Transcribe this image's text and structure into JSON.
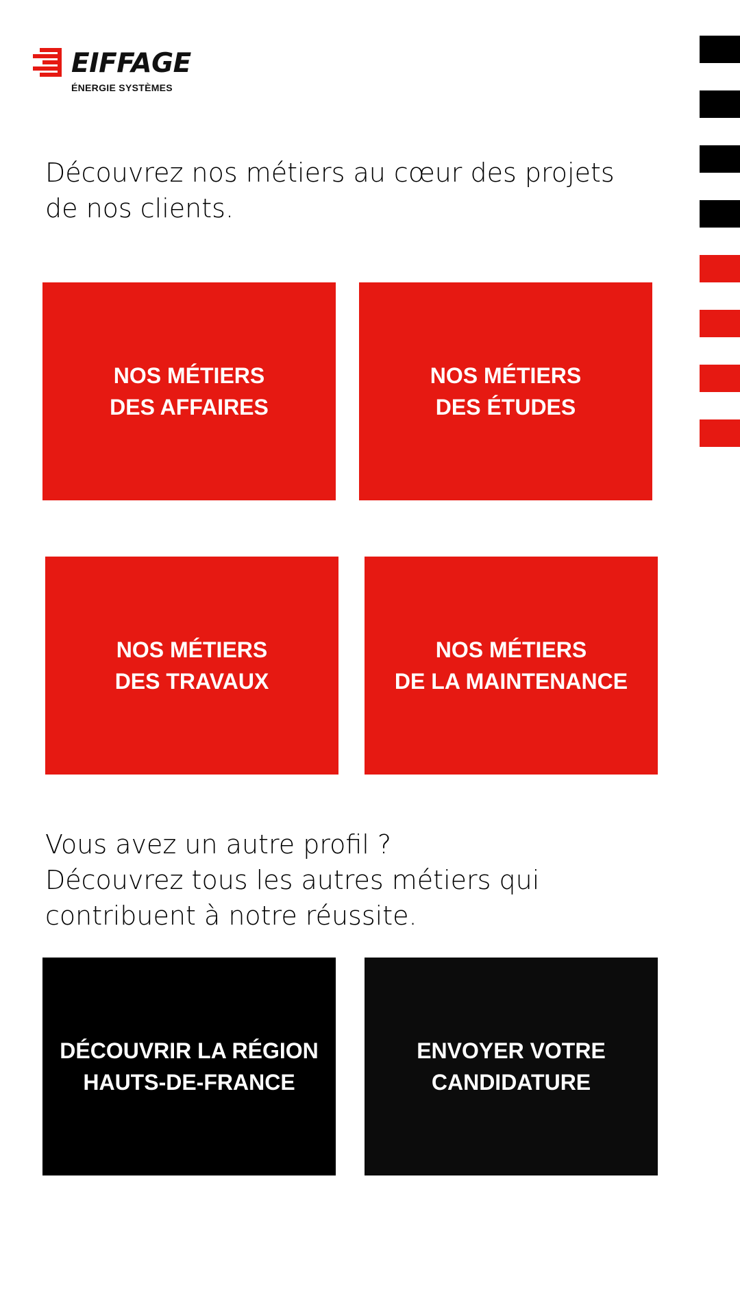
{
  "colors": {
    "red": "#e61912",
    "black": "#000000",
    "dark": "#0c0c0c",
    "white": "#ffffff"
  },
  "logo": {
    "wordmark": "EIFFAGE",
    "subtitle": "ÉNERGIE SYSTÈMES"
  },
  "intro": {
    "line1": "Découvrez nos métiers au cœur des projets",
    "line2": "de nos clients."
  },
  "tiles": [
    {
      "line1": "NOS MÉTIERS",
      "line2": "DES AFFAIRES"
    },
    {
      "line1": "NOS MÉTIERS",
      "line2": "DES ÉTUDES"
    },
    {
      "line1": "NOS MÉTIERS",
      "line2": "DES TRAVAUX"
    },
    {
      "line1": "NOS MÉTIERS",
      "line2": "DE LA MAINTENANCE"
    }
  ],
  "other": {
    "line1": "Vous avez un autre profil ?",
    "line2": "Découvrez tous les autres métiers qui",
    "line3": "contribuent à notre réussite."
  },
  "actions": [
    {
      "line1": "DÉCOUVRIR LA RÉGION",
      "line2": "HAUTS-DE-FRANCE"
    },
    {
      "line1": "ENVOYER VOTRE",
      "line2": "CANDIDATURE"
    }
  ],
  "side_squares": [
    "black",
    "black",
    "black",
    "black",
    "red",
    "red",
    "red",
    "red"
  ]
}
